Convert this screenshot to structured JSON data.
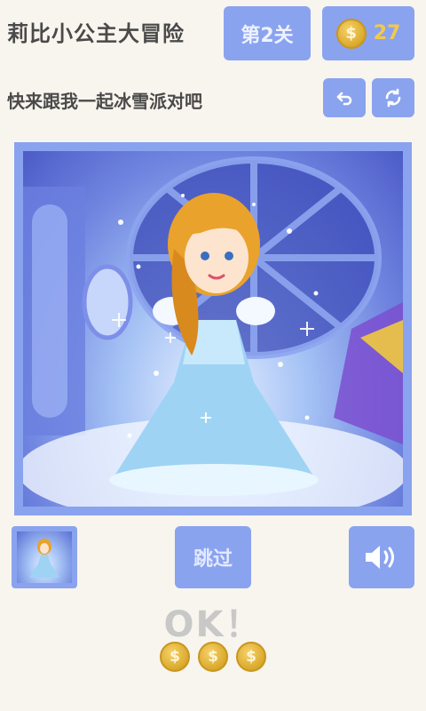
{
  "header": {
    "title": "莉比小公主大冒险",
    "level_label": "第2关",
    "coin_symbol": "$",
    "coin_count": "27"
  },
  "prompt": {
    "text": "快来跟我一起冰雪派对吧"
  },
  "buttons": {
    "undo_icon": "undo-icon",
    "refresh_icon": "refresh-icon",
    "skip_label": "跳过",
    "sound_icon": "speaker-icon"
  },
  "result": {
    "text": "OK！",
    "coin_symbol": "$",
    "coins_earned": 3
  },
  "colors": {
    "background": "#f8f5ee",
    "button": "#8aa3ef",
    "coin": "#e0b23a",
    "ok_text": "#c8c8c8"
  }
}
